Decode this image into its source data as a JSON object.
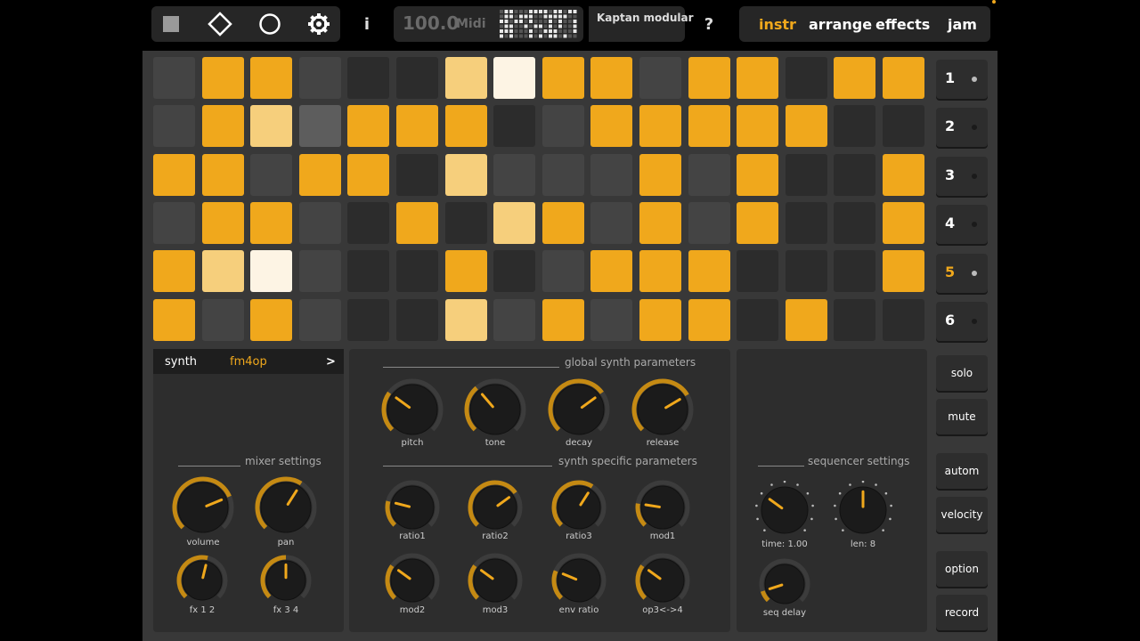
{
  "colors": {
    "accent": "#f0a81c",
    "accent_light": "#f6cf7c",
    "accent_white": "#fdf4e4",
    "pad_off": "#444444",
    "panel": "#2d2d2d"
  },
  "transport": {
    "stop": "stop-icon",
    "play": "diamond-play-icon",
    "record": "circle-record-icon",
    "settings": "gear-icon"
  },
  "info_label": "i",
  "help_label": "?",
  "tempo": {
    "bpm": "100.0",
    "source": "Midi"
  },
  "preset_name": "Kaptan modular",
  "modes": [
    {
      "label": "instr",
      "active": true
    },
    {
      "label": "arrange",
      "active": false
    },
    {
      "label": "effects",
      "active": false
    },
    {
      "label": "jam",
      "active": false
    }
  ],
  "pattern": [
    "0OO0dLWOO0OOdOO",
    "0OLlOOOd0OOOOdd",
    "OO0OOdLO00O0Odd",
    "0OO0dOdLO0O0OddO",
    "OLW0ddOd0OOOddd",
    "O0O0ddL0O0OOdOdd"
  ],
  "pattern_grid": [
    [
      "x",
      "O",
      "O",
      "x",
      "d",
      "d",
      "L",
      "W",
      "O",
      "O",
      "x",
      "O",
      "O",
      "d",
      "O",
      "O"
    ],
    [
      "x",
      "O",
      "L",
      "l",
      "O",
      "O",
      "O",
      "d",
      "x",
      "O",
      "O",
      "O",
      "O",
      "O",
      "d",
      "d"
    ],
    [
      "O",
      "O",
      "x",
      "O",
      "O",
      "d",
      "L",
      "x",
      "x",
      "x",
      "O",
      "x",
      "O",
      "d",
      "d",
      "O"
    ],
    [
      "x",
      "O",
      "O",
      "x",
      "d",
      "O",
      "d",
      "L",
      "O",
      "x",
      "O",
      "x",
      "O",
      "d",
      "d",
      "O"
    ],
    [
      "O",
      "L",
      "W",
      "x",
      "d",
      "d",
      "O",
      "d",
      "x",
      "O",
      "O",
      "O",
      "d",
      "d",
      "d",
      "O"
    ],
    [
      "O",
      "x",
      "O",
      "x",
      "d",
      "d",
      "L",
      "x",
      "O",
      "x",
      "O",
      "O",
      "d",
      "O",
      "d",
      "d"
    ]
  ],
  "tracks": [
    {
      "label": "1",
      "lit": true
    },
    {
      "label": "2",
      "lit": false
    },
    {
      "label": "3",
      "lit": false
    },
    {
      "label": "4",
      "lit": false
    },
    {
      "label": "5",
      "lit": true,
      "active": true
    },
    {
      "label": "6",
      "lit": false
    }
  ],
  "track_options": [
    "solo",
    "mute",
    "autom",
    "velocity",
    "option",
    "record"
  ],
  "synth": {
    "label": "synth",
    "engine": "fm4op",
    "next": ">"
  },
  "mixer": {
    "title": "mixer settings",
    "knobs": [
      {
        "label": "volume",
        "value": 0.75
      },
      {
        "label": "pan",
        "value": 0.62
      },
      {
        "label": "fx 1 2",
        "value": 0.55
      },
      {
        "label": "fx 3 4",
        "value": 0.5
      }
    ]
  },
  "global": {
    "title": "global synth parameters",
    "knobs": [
      {
        "label": "pitch",
        "value": 0.3
      },
      {
        "label": "tone",
        "value": 0.35
      },
      {
        "label": "decay",
        "value": 0.7
      },
      {
        "label": "release",
        "value": 0.72
      }
    ]
  },
  "specific": {
    "title": "synth specific parameters",
    "knobs": [
      {
        "label": "ratio1",
        "value": 0.22
      },
      {
        "label": "ratio2",
        "value": 0.7
      },
      {
        "label": "ratio3",
        "value": 0.62
      },
      {
        "label": "mod1",
        "value": 0.2
      },
      {
        "label": "mod2",
        "value": 0.3
      },
      {
        "label": "mod3",
        "value": 0.3
      },
      {
        "label": "env ratio",
        "value": 0.25
      },
      {
        "label": "op3<->4",
        "value": 0.3
      }
    ]
  },
  "sequencer": {
    "title": "sequencer settings",
    "knobs": [
      {
        "label": "time: 1.00",
        "value": 0.3
      },
      {
        "label": "len: 8",
        "value": 0.5
      },
      {
        "label": "seq delay",
        "value": 0.1
      }
    ]
  }
}
